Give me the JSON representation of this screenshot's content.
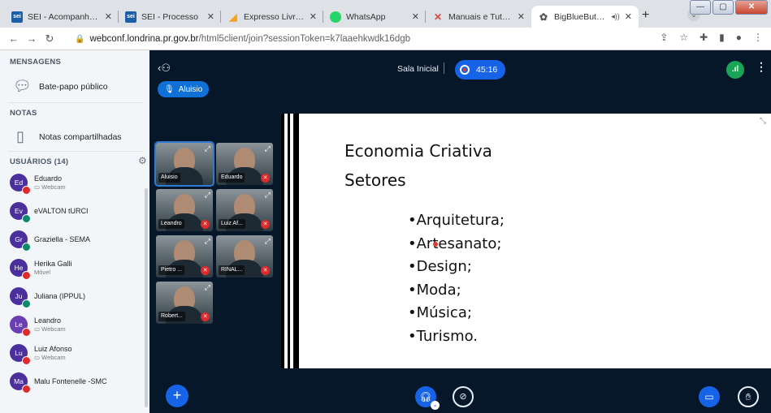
{
  "browser": {
    "tabs": [
      {
        "label": "SEI - Acompanhame",
        "icon": "sei-icon",
        "fav": "sei"
      },
      {
        "label": "SEI - Processo",
        "icon": "sei-icon",
        "fav": "sei"
      },
      {
        "label": "Expresso Livre [Expre",
        "icon": "expresso-icon",
        "fav": "expresso"
      },
      {
        "label": "WhatsApp",
        "icon": "whatsapp-icon",
        "fav": "wa"
      },
      {
        "label": "Manuais e Tutoriais",
        "icon": "manual-icon",
        "fav": "manual"
      },
      {
        "label": "BigBlueButton - ",
        "icon": "bbb-icon",
        "fav": "bbb"
      }
    ],
    "url_host": "webconf.londrina.pr.gov.br",
    "url_path": "/html5client/join?sessionToken=k7laaehkwdk16dgb"
  },
  "sidebar": {
    "messages_title": "MENSAGENS",
    "public_chat": "Bate-papo público",
    "notes_title": "NOTAS",
    "shared_notes": "Notas compartilhadas",
    "users_title": "USUÁRIOS (14)",
    "users": [
      {
        "initials": "Ed",
        "name": "Eduardo",
        "sub": "▭ Webcam",
        "status": "muted",
        "color": "#4b2f9c"
      },
      {
        "initials": "Ev",
        "name": "eVALTON tURCI",
        "sub": "",
        "status": "listen",
        "color": "#4b2f9c"
      },
      {
        "initials": "Gr",
        "name": "Graziella - SEMA",
        "sub": "",
        "status": "listen",
        "color": "#4b2f9c"
      },
      {
        "initials": "He",
        "name": "Herika Galli",
        "sub": "Móvel",
        "status": "muted",
        "color": "#4b2f9c"
      },
      {
        "initials": "Ju",
        "name": "Juliana (IPPUL)",
        "sub": "",
        "status": "listen",
        "color": "#4b2f9c"
      },
      {
        "initials": "Le",
        "name": "Leandro",
        "sub": "▭ Webcam",
        "status": "muted",
        "color": "#6b3fb4"
      },
      {
        "initials": "Lu",
        "name": "Luiz Afonso",
        "sub": "▭ Webcam",
        "status": "muted",
        "color": "#4b2f9c"
      },
      {
        "initials": "Ma",
        "name": "Malu Fontenelle -SMC",
        "sub": "",
        "status": "muted",
        "color": "#4b2f9c"
      }
    ]
  },
  "meeting": {
    "talking_user": "Aluisio",
    "room_name": "Sala Inicial",
    "timer": "45:16",
    "videos": [
      {
        "name": "Aluisio"
      },
      {
        "name": "Eduardo"
      },
      {
        "name": "Leandro"
      },
      {
        "name": "Luiz Af..."
      },
      {
        "name": "Pietro ..."
      },
      {
        "name": "RINAL..."
      },
      {
        "name": "Robert..."
      }
    ]
  },
  "slide": {
    "title": "Economia Criativa",
    "subtitle": "Setores",
    "bullets": [
      "•Arquitetura;",
      "•Artesanato;",
      "•Design;",
      "•Moda;",
      "•Música;",
      "•Turismo."
    ]
  },
  "colors": {
    "accent": "#1763e8",
    "background": "#06172a",
    "muted": "#de2a2a",
    "listen": "#0a8a6a"
  }
}
